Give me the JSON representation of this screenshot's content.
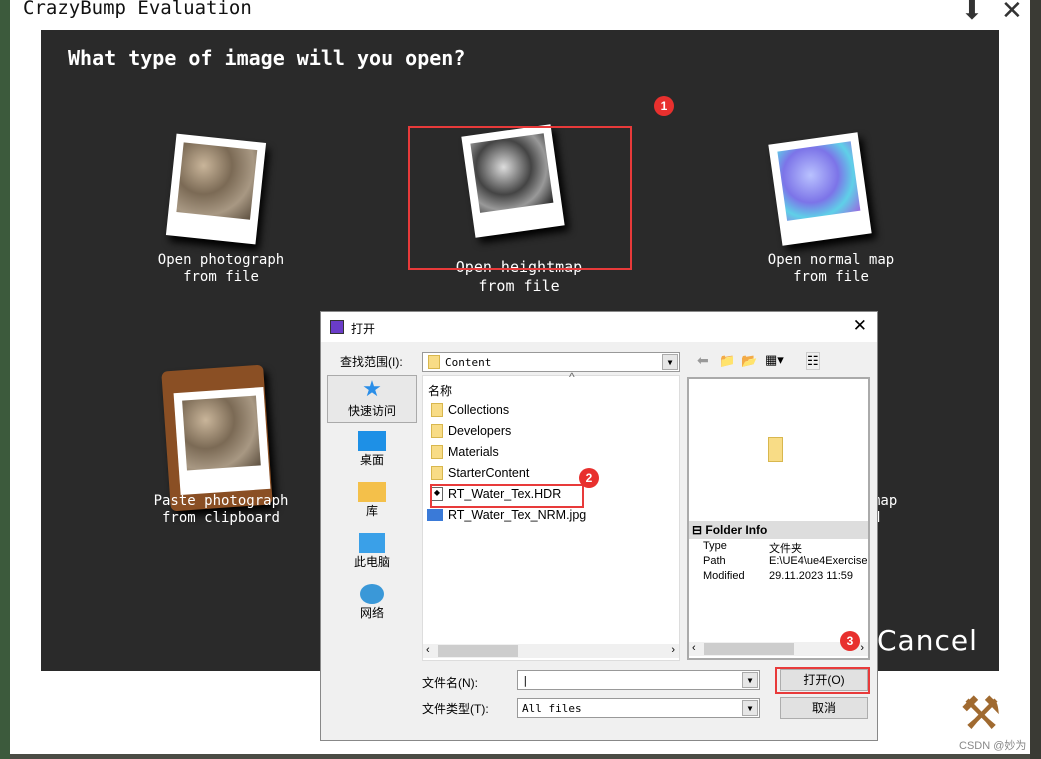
{
  "window": {
    "title": "CrazyBump Evaluation",
    "minimize_icon": "arrow-down-icon",
    "close_icon": "x-icon"
  },
  "panel": {
    "question": "What type of image will you open?",
    "options": [
      {
        "line1": "Open photograph",
        "line2": "from file"
      },
      {
        "line1": "Open heightmap",
        "line2": "from file"
      },
      {
        "line1": "Open normal map",
        "line2": "from file"
      },
      {
        "line1": "Paste photograph",
        "line2": "from clipboard"
      },
      {
        "line1": "map",
        "line2": "d"
      }
    ],
    "cancel": "Cancel"
  },
  "annotations": {
    "badge1": "1",
    "badge2": "2",
    "badge3": "3",
    "accent": "#e83a3a"
  },
  "dialog": {
    "title": "打开",
    "look_in_label": "查找范围(I):",
    "look_in_value": "Content",
    "places": [
      "快速访问",
      "桌面",
      "库",
      "此电脑",
      "网络"
    ],
    "column_header": "名称",
    "files": [
      {
        "name": "Collections",
        "type": "folder"
      },
      {
        "name": "Developers",
        "type": "folder"
      },
      {
        "name": "Materials",
        "type": "folder"
      },
      {
        "name": "StarterContent",
        "type": "folder"
      },
      {
        "name": "RT_Water_Tex.HDR",
        "type": "hdr"
      },
      {
        "name": "RT_Water_Tex_NRM.jpg",
        "type": "image"
      }
    ],
    "folder_info": {
      "header": "Folder Info",
      "rows": [
        {
          "k": "Type",
          "v": "文件夹"
        },
        {
          "k": "Path",
          "v": "E:\\UE4\\ue4Exercise"
        },
        {
          "k": "Modified",
          "v": "29.11.2023 11:59"
        }
      ]
    },
    "filename_label": "文件名(N):",
    "filename_value": "",
    "filetype_label": "文件类型(T):",
    "filetype_value": "All files",
    "open_button": "打开(O)",
    "cancel_button": "取消"
  },
  "watermark": "CSDN @妙为"
}
